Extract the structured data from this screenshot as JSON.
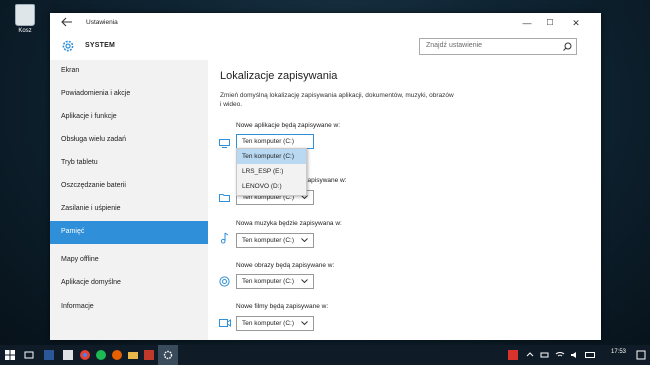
{
  "desktop": {
    "recycle_bin_label": "Kosz"
  },
  "window": {
    "app_title": "Ustawienia",
    "controls": {
      "minimize": "—",
      "maximize": "☐",
      "close": "✕"
    },
    "section_title": "SYSTEM",
    "search_placeholder": "Znajdź ustawienie"
  },
  "sidebar": {
    "items": [
      {
        "label": "Ekran"
      },
      {
        "label": "Powiadomienia i akcje"
      },
      {
        "label": "Aplikacje i funkcje"
      },
      {
        "label": "Obsługa wielu zadań"
      },
      {
        "label": "Tryb tabletu"
      },
      {
        "label": "Oszczędzanie baterii"
      },
      {
        "label": "Zasilanie i uśpienie"
      },
      {
        "label": "Pamięć",
        "active": true
      },
      {
        "label": "Mapy offline"
      },
      {
        "label": "Aplikacje domyślne"
      },
      {
        "label": "Informacje"
      }
    ]
  },
  "main": {
    "title": "Lokalizacje zapisywania",
    "description": "Zmień domyślną lokalizację zapisywania aplikacji, dokumentów, muzyki, obrazów i wideo.",
    "groups": [
      {
        "label": "Nowe aplikacje będą zapisywane w:",
        "value": "Ten komputer (C:)",
        "icon": "monitor-icon"
      },
      {
        "label": "Nowe dokumenty będą zapisywane w:",
        "value": "Ten komputer (C:)",
        "icon": "folder-icon"
      },
      {
        "label": "Nowa muzyka będzie zapisywana w:",
        "value": "Ten komputer (C:)",
        "icon": "music-note-icon"
      },
      {
        "label": "Nowe obrazy będą zapisywane w:",
        "value": "Ten komputer (C:)",
        "icon": "camera-icon"
      },
      {
        "label": "Nowe filmy będą zapisywane w:",
        "value": "Ten komputer (C:)",
        "icon": "video-icon"
      }
    ],
    "open_dropdown": {
      "options": [
        "Ten komputer (C:)",
        "LRS_ESP (E:)",
        "LENOVO (D:)"
      ],
      "selected": "Ten komputer (C:)"
    }
  },
  "taskbar": {
    "icons": [
      "start-icon",
      "task-view-icon",
      "word-icon",
      "outlook-icon",
      "chrome-icon",
      "spotify-icon",
      "firefox-icon",
      "folder-icon",
      "app-icon",
      "store-icon",
      "settings-icon"
    ],
    "clock": "17:53",
    "accent_color": "#2f8fd8"
  }
}
